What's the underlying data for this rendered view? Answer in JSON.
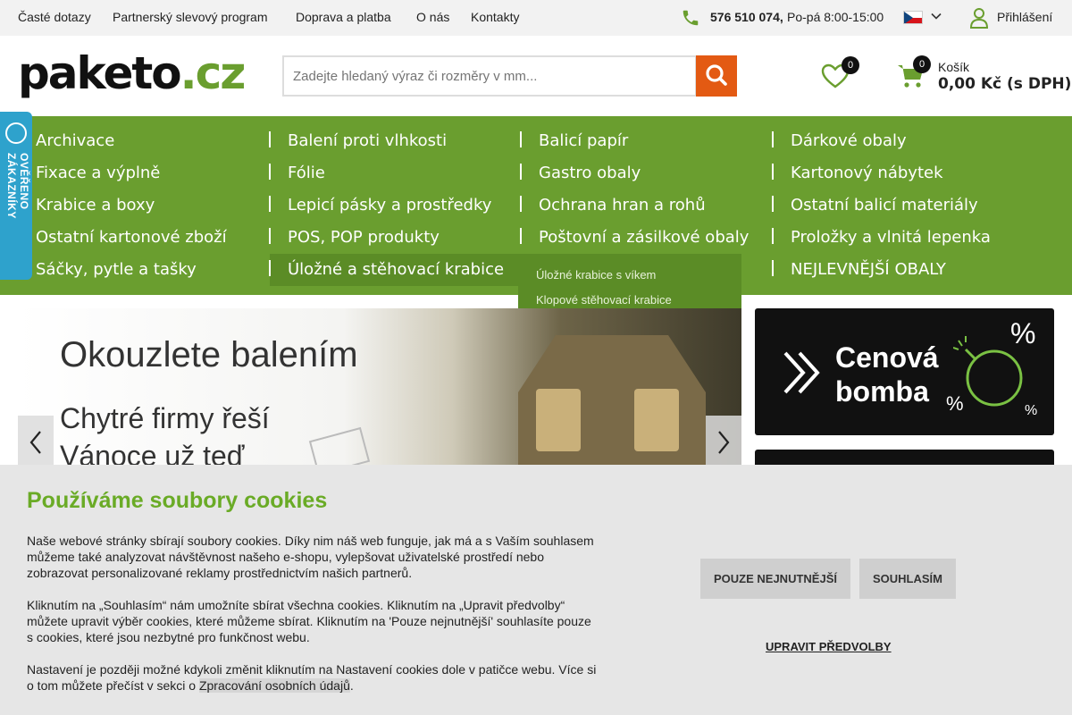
{
  "topbar": {
    "links": [
      "Časté dotazy",
      "Partnerský slevový program",
      "Doprava a platba",
      "O nás",
      "Kontakty"
    ],
    "phone": "576 510 074,",
    "hours": "Po-pá 8:00-15:00",
    "login": "Přihlášení"
  },
  "header": {
    "logo_main": "paketo",
    "logo_tld": ".cz",
    "search_placeholder": "Zadejte hledaný výraz či rozměry v mm...",
    "wishlist_count": "0",
    "cart_count": "0",
    "cart_label": "Košík",
    "cart_total": "0,00 Kč (s DPH)"
  },
  "categories": {
    "col1": [
      "Archivace",
      "Fixace a výplně",
      "Krabice a boxy",
      "Ostatní kartonové zboží",
      "Sáčky, pytle a tašky"
    ],
    "col2": [
      "Balení proti vlhkosti",
      "Fólie",
      "Lepicí pásky a prostředky",
      "POS, POP produkty",
      "Úložné a stěhovací krabice"
    ],
    "col3": [
      "Balicí papír",
      "Gastro obaly",
      "Ochrana hran a rohů",
      "Poštovní a zásilkové obaly"
    ],
    "col4": [
      "Dárkové obaly",
      "Kartonový nábytek",
      "Ostatní balicí materiály",
      "Proložky a vlnitá lepenka",
      "NEJLEVNĚJŠÍ OBALY"
    ],
    "submenu": [
      "Úložné krabice s víkem",
      "Klopové stěhovací krabice"
    ]
  },
  "verified_badge": "OVĚŘENO ZÁKAZNÍKY",
  "hero": {
    "title": "Okouzlete balením",
    "subtitle_line1": "Chytré firmy řeší",
    "subtitle_line2": "Vánoce už teď"
  },
  "promo": {
    "line1": "Cenová",
    "line2": "bomba",
    "pct": "%"
  },
  "cookies": {
    "title": "Používáme soubory cookies ",
    "p1": "Naše webové stránky sbírají soubory cookies. Díky nim náš web funguje, jak má a s Vaším souhlasem můžeme také analyzovat návštěvnost našeho e-shopu, vylepšovat uživatelské prostředí nebo zobrazovat personalizované reklamy prostřednictvím našich partnerů.",
    "p2": "Kliknutím na „Souhlasím“ nám umožníte sbírat všechna cookies. Kliknutím na „Upravit předvolby“ můžete upravit výběr cookies, které můžeme sbírat. Kliknutím na 'Pouze nejnutnější' souhlasíte pouze s cookies, které jsou nezbytné pro funkčnost webu.",
    "p3_before": "Nastavení je později možné kdykoli změnit kliknutím na Nastavení cookies dole v patičce webu. Více si o tom můžete přečíst v sekci o ",
    "p3_link": "Zpracování osobních údajů",
    "p3_after": ".",
    "btn_necessary": "POUZE NEJNUTNĚJŠÍ",
    "btn_agree": "SOUHLASÍM",
    "btn_edit": "UPRAVIT PŘEDVOLBY"
  },
  "colors": {
    "brand_green": "#6a9e2f",
    "search_orange": "#e35a13",
    "cookie_title_green": "#6aab26",
    "badge_blue": "#2ea2cc"
  },
  "icons": [
    "phone-icon",
    "chevron-down-icon",
    "user-icon",
    "search-icon",
    "heart-icon",
    "cart-icon",
    "arrow-left-icon",
    "arrow-right-icon",
    "double-chevron-icon",
    "bomb-icon"
  ]
}
